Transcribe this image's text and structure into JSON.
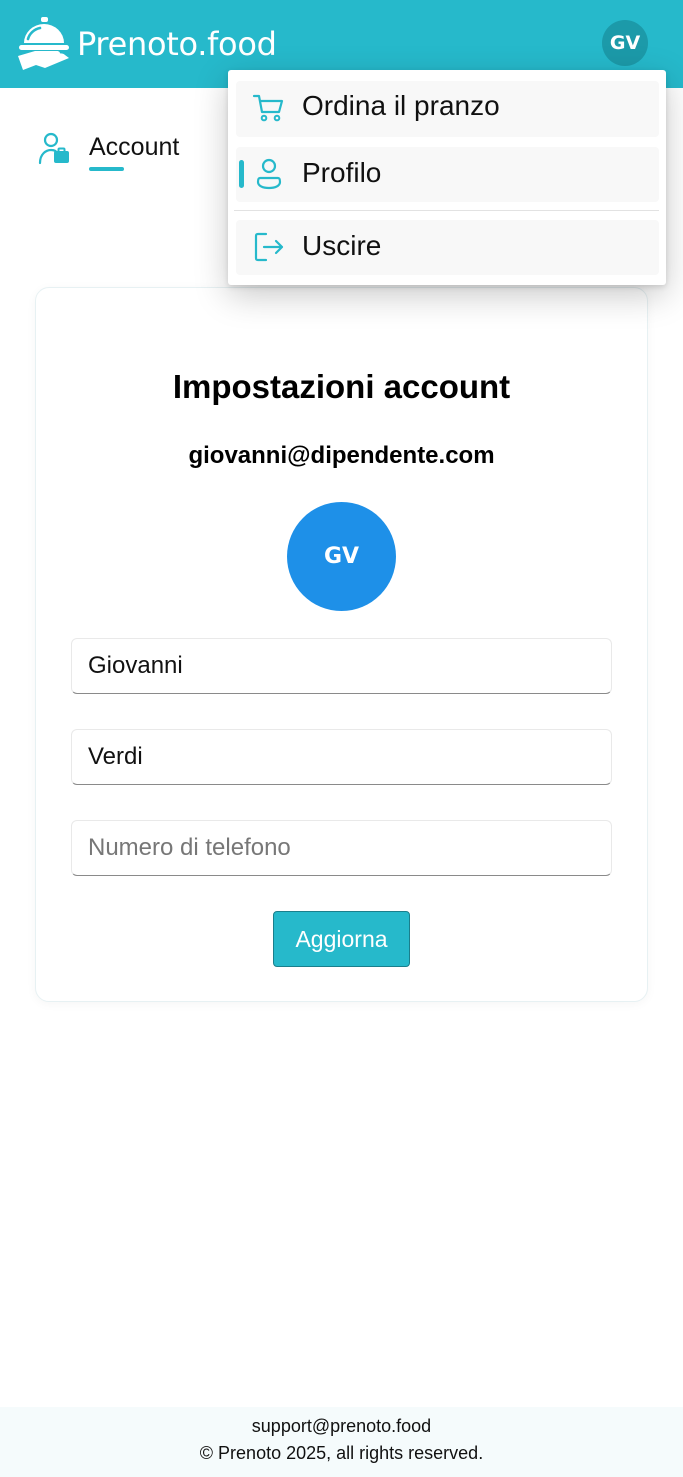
{
  "app": {
    "name": "Prenoto.food",
    "user_initials": "GV",
    "accent_color": "#26b9cb"
  },
  "header": {
    "brand_icon": "serving-cloche-hand-icon",
    "avatar_initials": "GV"
  },
  "nav": {
    "account_label": "Account",
    "account_icon": "user-briefcase-icon"
  },
  "user_menu": {
    "items": [
      {
        "label": "Ordina il pranzo",
        "icon": "cart-icon",
        "active": false
      },
      {
        "label": "Profilo",
        "icon": "user-icon",
        "active": true
      },
      {
        "label": "Uscire",
        "icon": "logout-icon",
        "active": false
      }
    ]
  },
  "account_card": {
    "title": "Impostazioni account",
    "email": "giovanni@dipendente.com",
    "avatar_initials": "GV",
    "avatar_color": "#1e90e8",
    "first_name": "Giovanni",
    "last_name": "Verdi",
    "phone": "",
    "phone_placeholder": "Numero di telefono",
    "update_label": "Aggiorna"
  },
  "footer": {
    "email": "support@prenoto.food",
    "copyright": "© Prenoto 2025, all rights reserved."
  }
}
